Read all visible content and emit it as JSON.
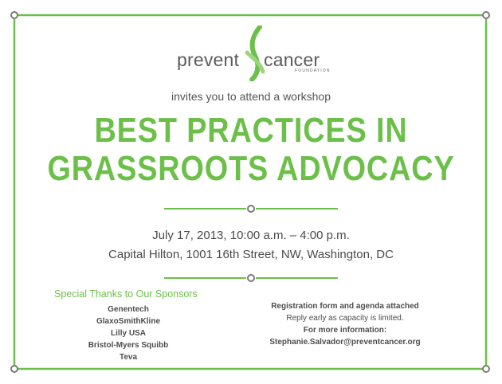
{
  "colors": {
    "accent": "#6cc04a",
    "frame_dot": "#888888",
    "text": "#4a4a4a"
  },
  "logo": {
    "word_left": "prevent",
    "word_right": "cancer",
    "subtitle": "FOUNDATION",
    "ribbon_icon": "ribbon-icon"
  },
  "invite_text": "invites you to attend a workshop",
  "headline": {
    "line1": "BEST PRACTICES IN",
    "line2": "GRASSROOTS ADVOCACY"
  },
  "event": {
    "date_time": "July 17, 2013, 10:00 a.m. – 4:00 p.m.",
    "venue": "Capital Hilton, 1001 16th Street, NW, Washington, DC"
  },
  "sponsors": {
    "title": "Special Thanks to Our Sponsors",
    "list": [
      "Genentech",
      "GlaxoSmithKline",
      "Lilly USA",
      "Bristol-Myers Squibb",
      "Teva"
    ]
  },
  "registration": {
    "line1": "Registration form and agenda attached",
    "line2": "Reply early as capacity is limited.",
    "line3": "For more information:",
    "email": "Stephanie.Salvador@preventcancer.org"
  }
}
